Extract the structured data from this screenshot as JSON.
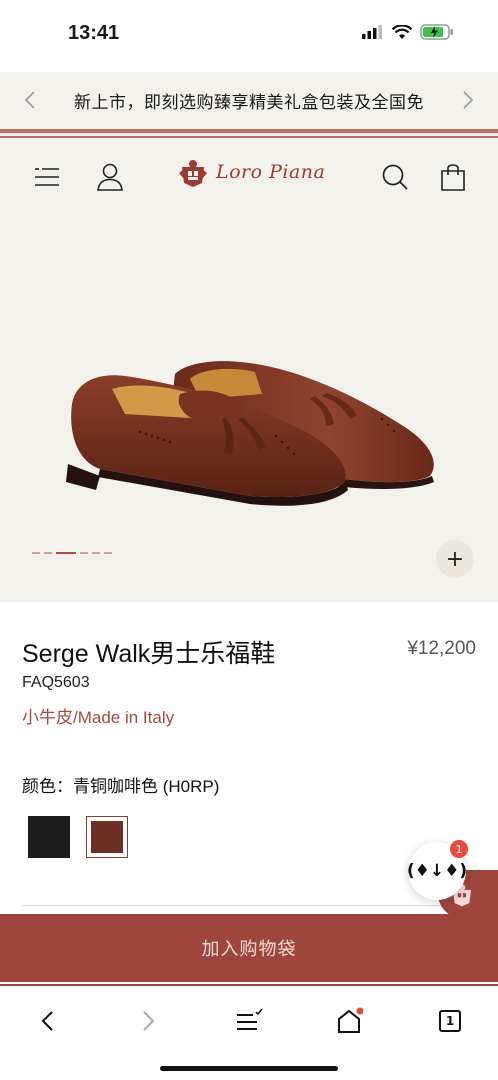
{
  "status_bar": {
    "time": "13:41"
  },
  "announcement": {
    "text": "新上市，即刻选购臻享精美礼盒包装及全国免"
  },
  "brand": {
    "name": "Loro Piana"
  },
  "gallery": {
    "image_count": 6,
    "active_index": 2,
    "zoom_label": "+"
  },
  "product": {
    "name": "Serge Walk男士乐福鞋",
    "price": "¥12,200",
    "sku": "FAQ5603",
    "material": "小牛皮/Made in Italy",
    "color_label": "颜色：青铜咖啡色 (H0RP)",
    "swatches": [
      "black",
      "bronze-coffee"
    ]
  },
  "floating": {
    "button_label": "(♦↓♦)",
    "badge": "1"
  },
  "cta": {
    "add_to_bag": "加入购物袋"
  },
  "browser_bar": {
    "tab_count": "1"
  },
  "colors": {
    "accent": "#9e463c",
    "background": "#f3f1ec",
    "material_text": "#a24a3f"
  }
}
